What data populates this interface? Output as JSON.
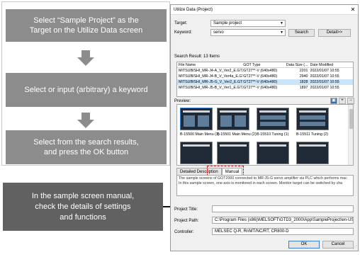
{
  "flow": {
    "step1": [
      "Select “Sample Project” as the",
      "Target on the Utilize Data screen"
    ],
    "step2": "Select or input (arbitrary) a keyword",
    "step3": [
      "Select from the search results,",
      "and press the OK button"
    ],
    "note": [
      "In the sample screen manual,",
      "check the details of settings",
      "and functions"
    ]
  },
  "dialog": {
    "title": "Utilize Data (Project)",
    "close": "✕",
    "target_label": "Target:",
    "target_value": "Sample project",
    "keyword_label": "Keyword:",
    "keyword_value": "servo",
    "search_button": "Search",
    "detail_button": "Detail>>",
    "search_result": "Search Result: 13 Items",
    "columns": [
      "File Name",
      "GOT Type",
      "Data Size (...",
      "Date Modified"
    ],
    "rows": [
      [
        "MITSUBISHI_MR-J4-A_V_Ver2_E.GTX",
        "GT27**-V (640x480)",
        "2201",
        "2022/01/07 10:55"
      ],
      [
        "MITSUBISHI_MR-J4-B_V_Ver4a_E.GTX",
        "GT27**-V (640x480)",
        "2940",
        "2022/01/07 10:55"
      ],
      [
        "MITSUBISHI_MR-J5-G_V_Ver2_E.GTX",
        "GT27**-V (640x480)",
        "1828",
        "2022/01/07 10:55"
      ],
      [
        "MITSUBISHI_MR-J5-B_V_Ver1_E.GTX",
        "GT27**-V (640x480)",
        "1897",
        "2022/01/07 10:55"
      ]
    ],
    "preview_label": "Preview:",
    "thumbs": [
      "B-15500 Main Menu (1)",
      "B-15501 Main Menu (2)",
      "B-15510 Tuning (1)",
      "B-15511 Tuning (2)"
    ],
    "tab_detailed": "Detailed Description",
    "tab_manual": "Manual",
    "description": [
      "The sample screens of GOT2000 connected to MR-J5-G servo amplifier via PLC which performs mac",
      "In this sample screen, one axis is monitored in each screen. Monitor target can be switched by cha"
    ],
    "project_title_label": "Project Title:",
    "project_title_value": "",
    "project_path_label": "Project Path:",
    "project_path_value": "C:\\Program Files (x86)\\MELSOFT\\GTD3_2000\\App\\SampleProject\\en-US\\MITS",
    "controller_label": "Controller:",
    "controller_value": "MELSEC Q-R, RnMT/NC/RT, CR800-D",
    "ok_button": "OK",
    "cancel_button": "Cancel"
  }
}
